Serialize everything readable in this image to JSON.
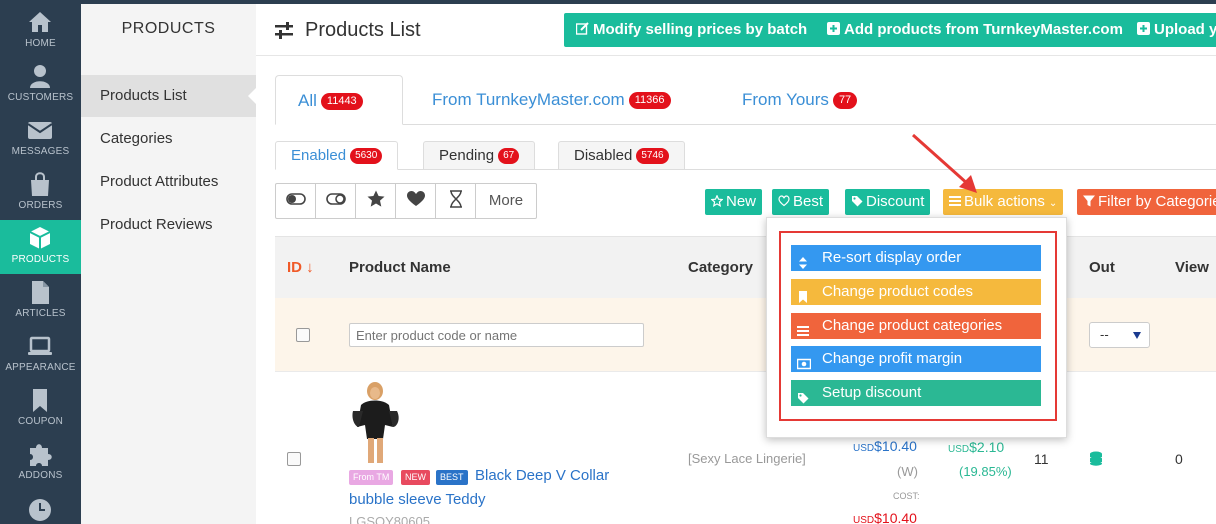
{
  "rail": [
    {
      "label": "HOME",
      "icon": "home-icon"
    },
    {
      "label": "CUSTOMERS",
      "icon": "user-icon"
    },
    {
      "label": "MESSAGES",
      "icon": "envelope-icon"
    },
    {
      "label": "ORDERS",
      "icon": "shopping-bag-icon"
    },
    {
      "label": "PRODUCTS",
      "icon": "cube-icon"
    },
    {
      "label": "ARTICLES",
      "icon": "file-icon"
    },
    {
      "label": "APPEARANCE",
      "icon": "laptop-icon"
    },
    {
      "label": "COUPON",
      "icon": "bookmark-icon"
    },
    {
      "label": "ADDONS",
      "icon": "puzzle-icon"
    }
  ],
  "subnav": {
    "title": "PRODUCTS",
    "items": [
      "Products List",
      "Categories",
      "Product Attributes",
      "Product Reviews"
    ]
  },
  "header": {
    "title": "Products List",
    "buttons": [
      "Modify selling prices by batch",
      "Add products from TurnkeyMaster.com",
      "Upload yo"
    ]
  },
  "tabs": [
    {
      "label": "All",
      "count": "11443"
    },
    {
      "label": "From TurnkeyMaster.com",
      "count": "11366"
    },
    {
      "label": "From Yours",
      "count": "77"
    }
  ],
  "subtabs": [
    {
      "label": "Enabled",
      "count": "5630"
    },
    {
      "label": "Pending",
      "count": "67"
    },
    {
      "label": "Disabled",
      "count": "5746"
    }
  ],
  "toolbar": {
    "more_label": "More",
    "filters": [
      {
        "label": "New",
        "color": "#1abc9c"
      },
      {
        "label": "Best",
        "color": "#1abc9c"
      },
      {
        "label": "Discount",
        "color": "#1abc9c"
      },
      {
        "label": "Bulk actions",
        "color": "#f5b93d"
      },
      {
        "label": "Filter by Categorie",
        "color": "#f0643c"
      }
    ]
  },
  "table": {
    "headers": {
      "id": "ID ↓",
      "name": "Product Name",
      "category": "Category",
      "out": "Out",
      "view": "View"
    },
    "search_placeholder": "Enter product code or name",
    "out_select": "--"
  },
  "product": {
    "tags": [
      "From TM",
      "NEW",
      "BEST"
    ],
    "name_line1": "Black Deep V Collar",
    "name_line2": "bubble sleeve Teddy",
    "code": "LGSQY80605",
    "category": "[Sexy Lace Lingerie]",
    "price_cur": "USD",
    "price": "$10.40",
    "price_note": "(W)",
    "cost_label": "COST:",
    "cost_cur": "USD",
    "cost": "$10.40",
    "profit_cur": "USD",
    "profit": "$2.10",
    "profit_pct": "(19.85%)",
    "stock": "11",
    "view": "0"
  },
  "bulk_menu": [
    {
      "label": "Re-sort display order",
      "color": "#3498f0",
      "icon": "sort-icon"
    },
    {
      "label": "Change product codes",
      "color": "#f5b93d",
      "icon": "bookmark-icon"
    },
    {
      "label": "Change product categories",
      "color": "#f0643c",
      "icon": "list-icon"
    },
    {
      "label": "Change profit margin",
      "color": "#3498f0",
      "icon": "money-icon"
    },
    {
      "label": "Setup discount",
      "color": "#2bb894",
      "icon": "tag-icon"
    }
  ]
}
